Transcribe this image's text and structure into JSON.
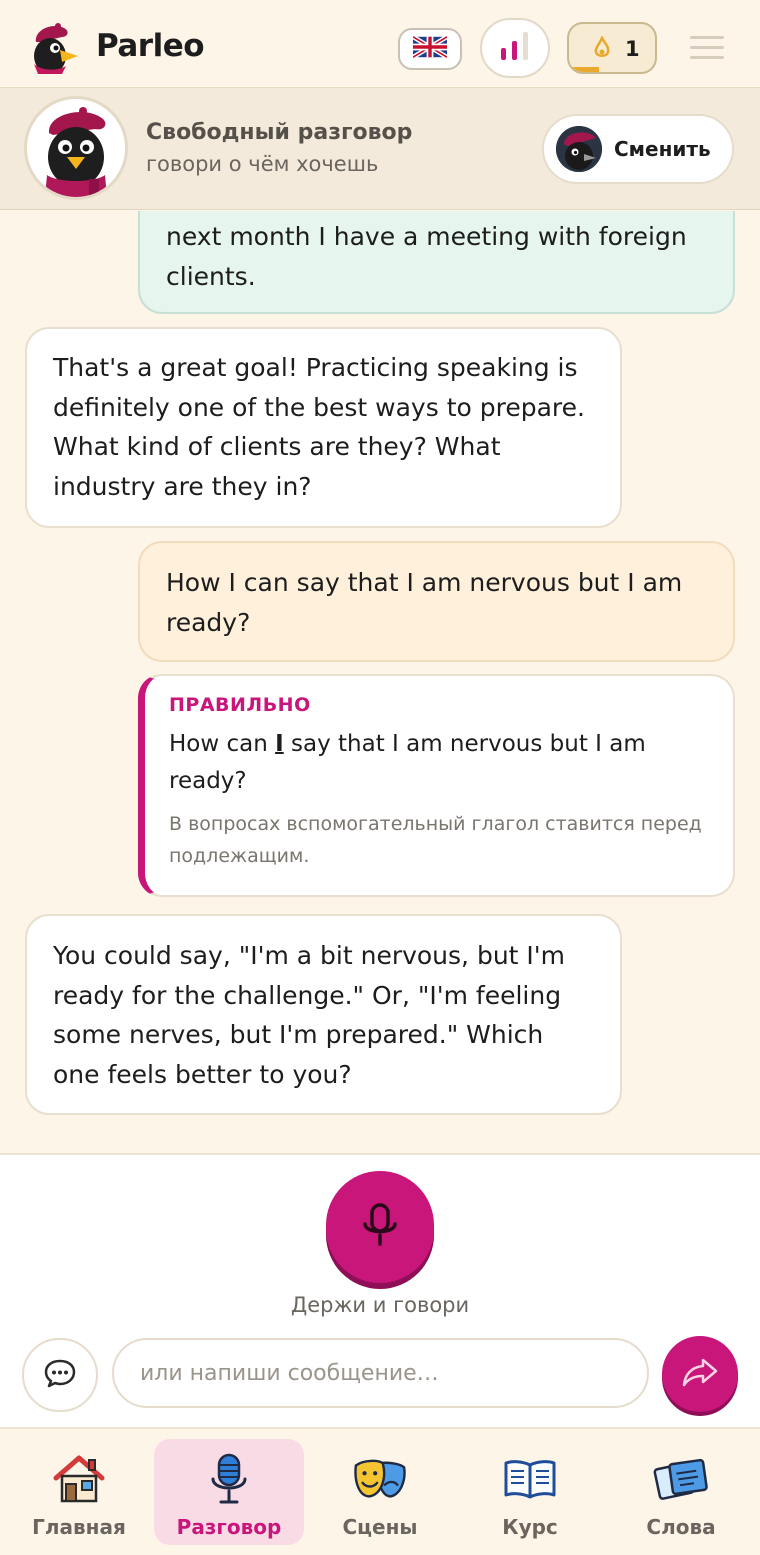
{
  "app": {
    "title": "Parleo"
  },
  "topbar": {
    "language_flag": "uk-flag-icon",
    "stats_icon": "bar-chart-icon",
    "streak_count": "1",
    "streak_icon": "flame-icon",
    "menu_icon": "hamburger-menu-icon"
  },
  "scenario": {
    "title": "Свободный разговор",
    "subtitle": "говори о чём хочешь",
    "switch_label": "Сменить"
  },
  "chat": {
    "messages": [
      {
        "role": "user",
        "text": "next month I have a meeting with foreign clients."
      },
      {
        "role": "assistant",
        "text": "That's a great goal! Practicing speaking is definitely one of the best ways to prepare. What kind of clients are they? What industry are they in?"
      },
      {
        "role": "user",
        "text": "How I can say that I am nervous but I am ready?"
      },
      {
        "role": "assistant",
        "text": "You could say, \"I'm a bit nervous, but I'm ready for the challenge.\" Or, \"I'm feeling some nerves, but I'm prepared.\" Which one feels better to you?"
      }
    ],
    "correction": {
      "label": "ПРАВИЛЬНО",
      "text_before": "How can ",
      "text_highlight": "I",
      "text_after": " say that I am nervous but I am ready?",
      "note": "В вопросах вспомогательный глагол ставится перед подлежащим."
    }
  },
  "voice": {
    "hold_label": "Держи и говори",
    "input_placeholder": "или напиши сообщение…",
    "input_value": ""
  },
  "nav": {
    "items": [
      {
        "label": "Главная",
        "icon": "home-icon",
        "active": false
      },
      {
        "label": "Разговор",
        "icon": "microphone-icon",
        "active": true
      },
      {
        "label": "Сцены",
        "icon": "theater-masks-icon",
        "active": false
      },
      {
        "label": "Курс",
        "icon": "open-book-icon",
        "active": false
      },
      {
        "label": "Слова",
        "icon": "word-cards-icon",
        "active": false
      }
    ]
  },
  "colors": {
    "accent": "#c8167a",
    "background": "#fdf6e8",
    "user_bubble": "#fff0dc",
    "user_bubble_earlier": "#e6f5ee"
  }
}
